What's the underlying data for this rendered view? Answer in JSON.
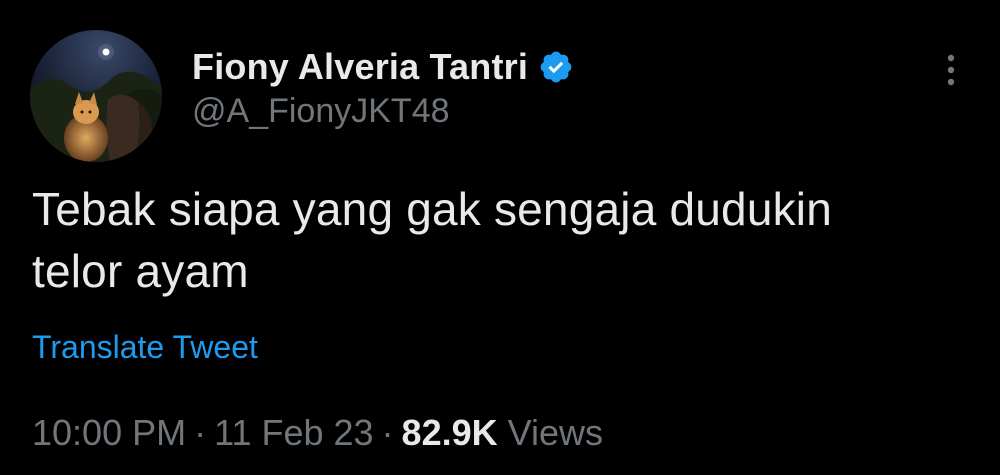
{
  "user": {
    "display_name": "Fiony Alveria Tantri",
    "handle": "@A_FionyJKT48",
    "verified": true
  },
  "tweet": {
    "text": "Tebak siapa yang gak sengaja dudukin\ntelor ayam",
    "translate_label": "Translate Tweet"
  },
  "meta": {
    "time": "10:00 PM",
    "separator": "·",
    "date": "11 Feb 23",
    "views_count": "82.9K",
    "views_label": "Views"
  },
  "icons": {
    "verified": "verified-badge-icon",
    "more": "more-options-icon"
  },
  "colors": {
    "background": "#000000",
    "text_primary": "#e7e9ea",
    "text_secondary": "#71767b",
    "accent": "#1d9bf0"
  }
}
